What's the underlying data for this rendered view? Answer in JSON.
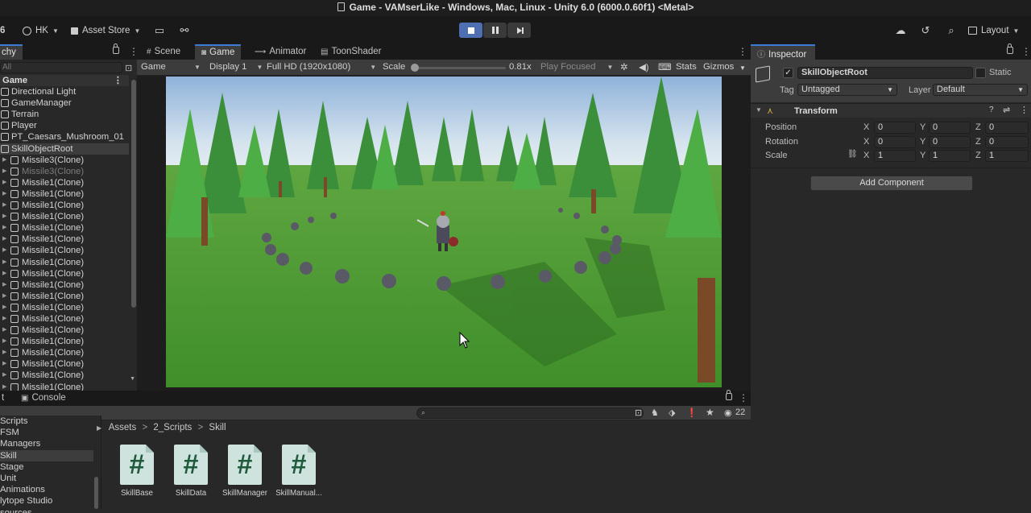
{
  "window": {
    "title": "Game - VAMserLike - Windows, Mac, Linux - Unity 6.0 (6000.0.60f1) <Metal>"
  },
  "toolbar": {
    "version_fragment": "6",
    "account": "HK",
    "asset_store": "Asset Store",
    "layout": "Layout"
  },
  "hierarchy": {
    "tab_label": "chy",
    "search_placeholder": "All",
    "scene_name": "Game",
    "items": [
      {
        "label": "Directional Light",
        "level": 0
      },
      {
        "label": "GameManager",
        "level": 0
      },
      {
        "label": "Terrain",
        "level": 0
      },
      {
        "label": "Player",
        "level": 0
      },
      {
        "label": "PT_Caesars_Mushroom_01",
        "level": 0
      },
      {
        "label": "SkillObjectRoot",
        "level": 0,
        "selected": true
      },
      {
        "label": "Missile3(Clone)",
        "level": 1
      },
      {
        "label": "Missile3(Clone)",
        "level": 1,
        "dim": true
      },
      {
        "label": "Missile1(Clone)",
        "level": 1
      },
      {
        "label": "Missile1(Clone)",
        "level": 1
      },
      {
        "label": "Missile1(Clone)",
        "level": 1
      },
      {
        "label": "Missile1(Clone)",
        "level": 1
      },
      {
        "label": "Missile1(Clone)",
        "level": 1
      },
      {
        "label": "Missile1(Clone)",
        "level": 1
      },
      {
        "label": "Missile1(Clone)",
        "level": 1
      },
      {
        "label": "Missile1(Clone)",
        "level": 1
      },
      {
        "label": "Missile1(Clone)",
        "level": 1
      },
      {
        "label": "Missile1(Clone)",
        "level": 1
      },
      {
        "label": "Missile1(Clone)",
        "level": 1
      },
      {
        "label": "Missile1(Clone)",
        "level": 1
      },
      {
        "label": "Missile1(Clone)",
        "level": 1
      },
      {
        "label": "Missile1(Clone)",
        "level": 1
      },
      {
        "label": "Missile1(Clone)",
        "level": 1
      },
      {
        "label": "Missile1(Clone)",
        "level": 1
      },
      {
        "label": "Missile1(Clone)",
        "level": 1
      },
      {
        "label": "Missile1(Clone)",
        "level": 1
      },
      {
        "label": "Missile1(Clone)",
        "level": 1
      }
    ]
  },
  "game_view": {
    "tabs": [
      "Scene",
      "Game",
      "Animator",
      "ToonShader"
    ],
    "active_tab": "Game",
    "view_mode": "Game",
    "display": "Display 1",
    "resolution": "Full HD (1920x1080)",
    "scale_label": "Scale",
    "scale_value": "0.81x",
    "play_mode": "Play Focused",
    "stats": "Stats",
    "gizmos": "Gizmos"
  },
  "inspector": {
    "tab_label": "Inspector",
    "object_name": "SkillObjectRoot",
    "static_label": "Static",
    "tag_label": "Tag",
    "tag_value": "Untagged",
    "layer_label": "Layer",
    "layer_value": "Default",
    "component": "Transform",
    "rows": [
      {
        "label": "Position",
        "x": "0",
        "y": "0",
        "z": "0"
      },
      {
        "label": "Rotation",
        "x": "0",
        "y": "0",
        "z": "0"
      },
      {
        "label": "Scale",
        "x": "1",
        "y": "1",
        "z": "1"
      }
    ],
    "axis_x": "X",
    "axis_y": "Y",
    "axis_z": "Z",
    "add_component": "Add Component"
  },
  "project": {
    "tabs": [
      "t",
      "Console"
    ],
    "folders": [
      "Scripts",
      "FSM",
      "Managers",
      "Skill",
      "Stage",
      "Unit",
      "Animations",
      "lytope Studio",
      "sources"
    ],
    "selected_folder": "Skill",
    "breadcrumb": [
      "Assets",
      "2_Scripts",
      "Skill"
    ],
    "hidden_count": "22",
    "assets": [
      {
        "name": "SkillBase"
      },
      {
        "name": "SkillData"
      },
      {
        "name": "SkillManager"
      },
      {
        "name": "SkillManual..."
      }
    ]
  },
  "colors": {
    "accent": "#3a7bd5",
    "play_active": "#4f6fb3",
    "script_icon": "#cfe3de"
  }
}
